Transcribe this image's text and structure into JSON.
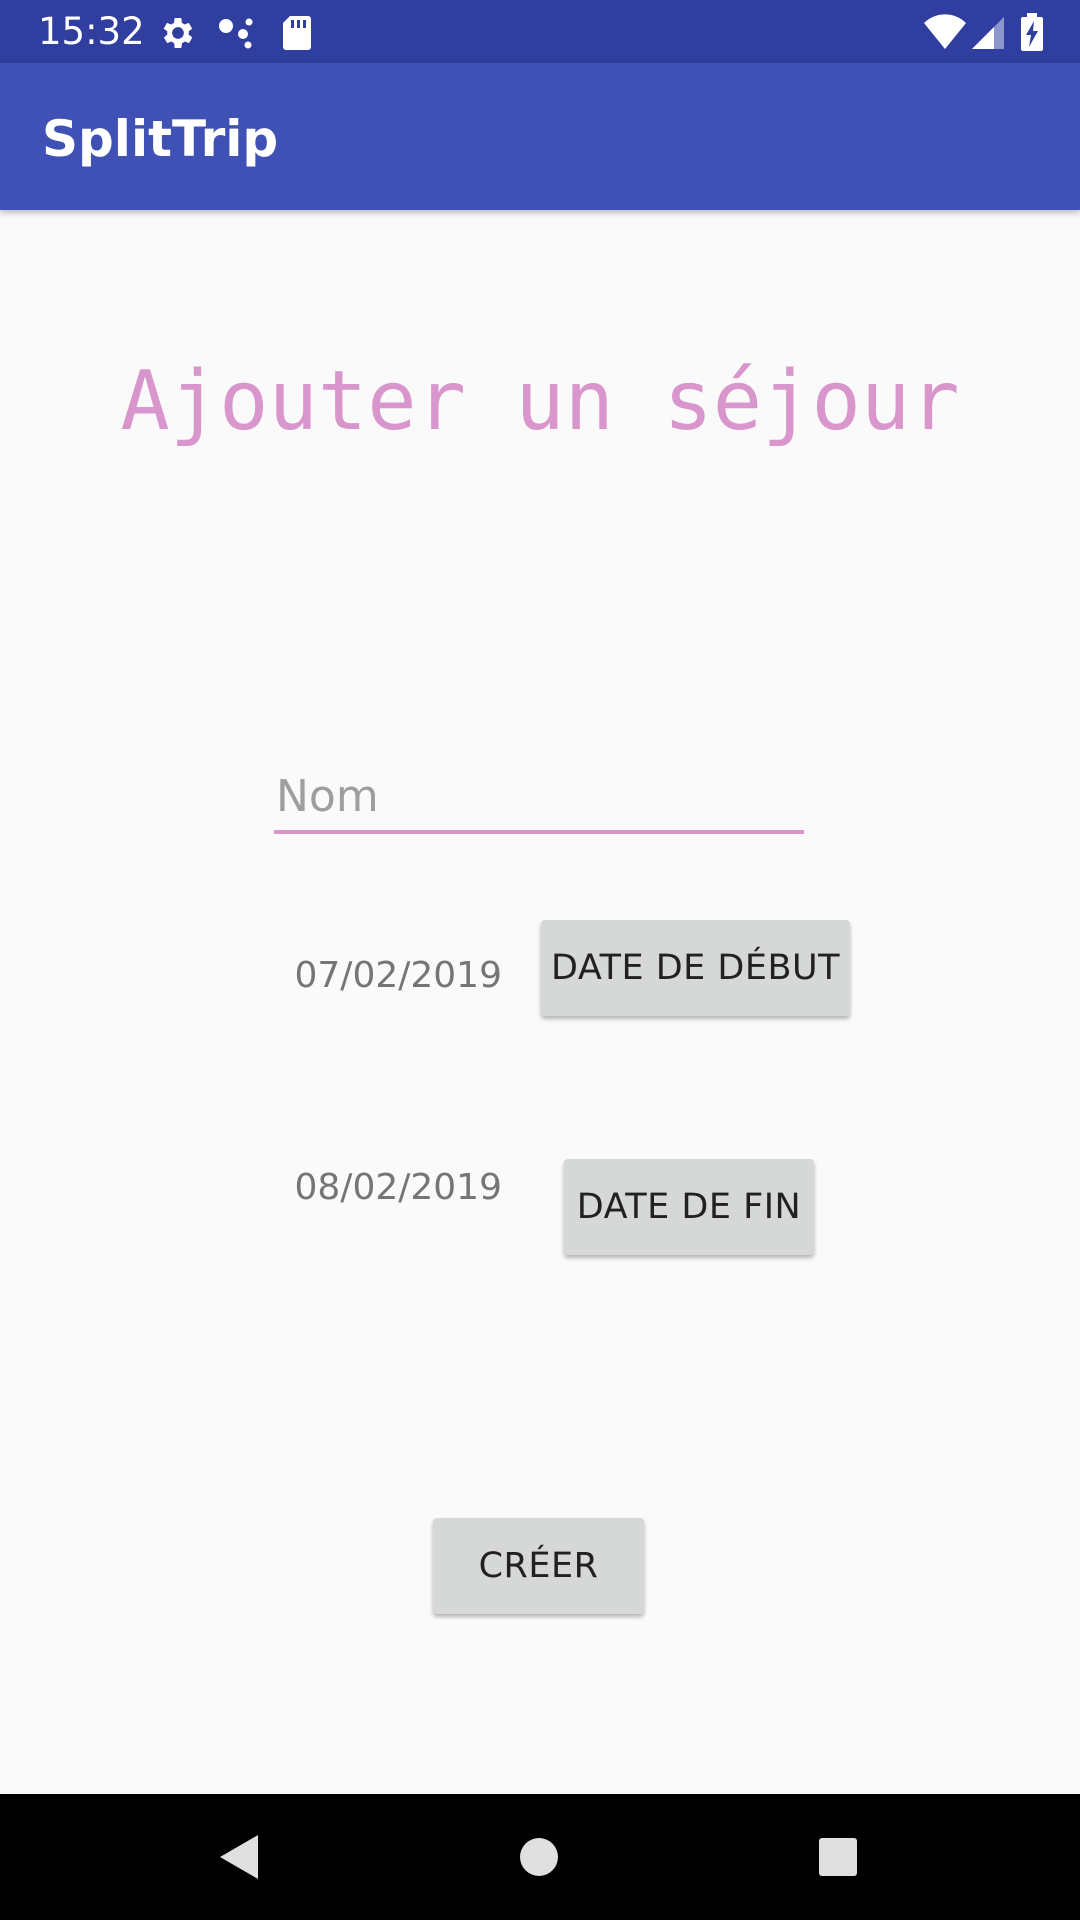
{
  "status_bar": {
    "time": "15:32",
    "icons": [
      "settings-icon",
      "sync-dots-icon",
      "sd-card-icon",
      "wifi-icon",
      "cell-signal-icon",
      "battery-charging-icon"
    ]
  },
  "app_bar": {
    "title": "SplitTrip",
    "color": "#3f51b5"
  },
  "form": {
    "heading": "Ajouter un séjour",
    "heading_color": "#d896cc",
    "name_placeholder": "Nom",
    "name_value": "",
    "start_date": "07/02/2019",
    "start_button_label": "DATE DE DÉBUT",
    "end_date": "08/02/2019",
    "end_button_label": "DATE DE FIN",
    "create_button_label": "CRÉER"
  },
  "nav_bar": {
    "buttons": [
      "back-icon",
      "home-icon",
      "recents-icon"
    ]
  }
}
